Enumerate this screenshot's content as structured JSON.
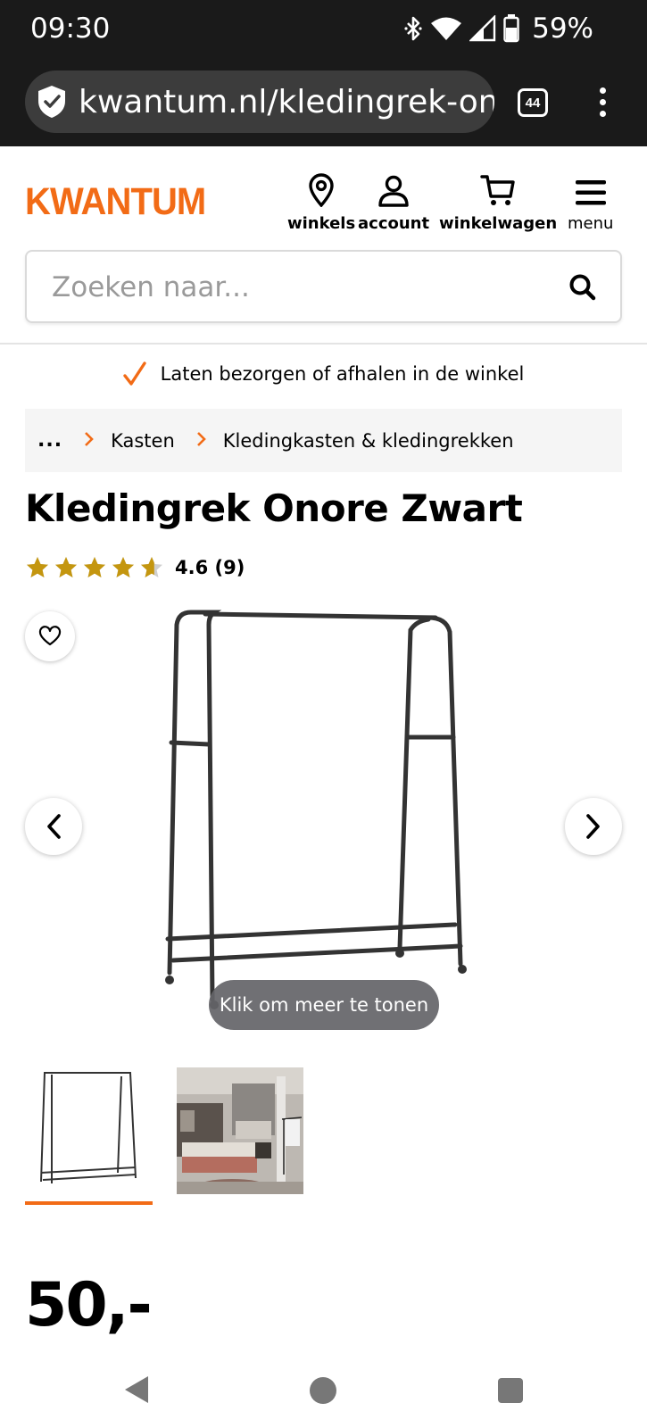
{
  "status_bar": {
    "time": "09:30",
    "battery_percent": "59%",
    "icons": [
      "bluetooth-icon",
      "wifi-icon",
      "cell-signal-icon",
      "battery-icon"
    ]
  },
  "browser": {
    "url": "kwantum.nl/kledingrek-onore-zwart",
    "tab_count": "44",
    "icons": [
      "shield-check-icon",
      "tab-switcher-icon",
      "more-vert-icon"
    ]
  },
  "header": {
    "logo": "KWANTUM",
    "nav": [
      {
        "label": "winkels",
        "icon": "location-pin-icon"
      },
      {
        "label": "account",
        "icon": "person-icon"
      },
      {
        "label": "winkelwagen",
        "icon": "cart-icon"
      },
      {
        "label": "menu",
        "icon": "hamburger-icon"
      }
    ],
    "search": {
      "placeholder": "Zoeken naar..."
    }
  },
  "usp": {
    "text": "Laten bezorgen of afhalen in de winkel"
  },
  "breadcrumb": {
    "ellipsis": "...",
    "items": [
      "Kasten",
      "Kledingkasten & kledingrekken"
    ]
  },
  "product": {
    "title": "Kledingrek Onore Zwart",
    "rating_value": 4.6,
    "rating_text": "4.6 (9)",
    "more_label": "Klik om meer te tonen",
    "price": "50,-",
    "selected_thumbnail": 1
  },
  "colors": {
    "brand_orange": "#f26b16",
    "star_gold": "#c4960f",
    "status_bar_bg": "#1a1a1a"
  }
}
